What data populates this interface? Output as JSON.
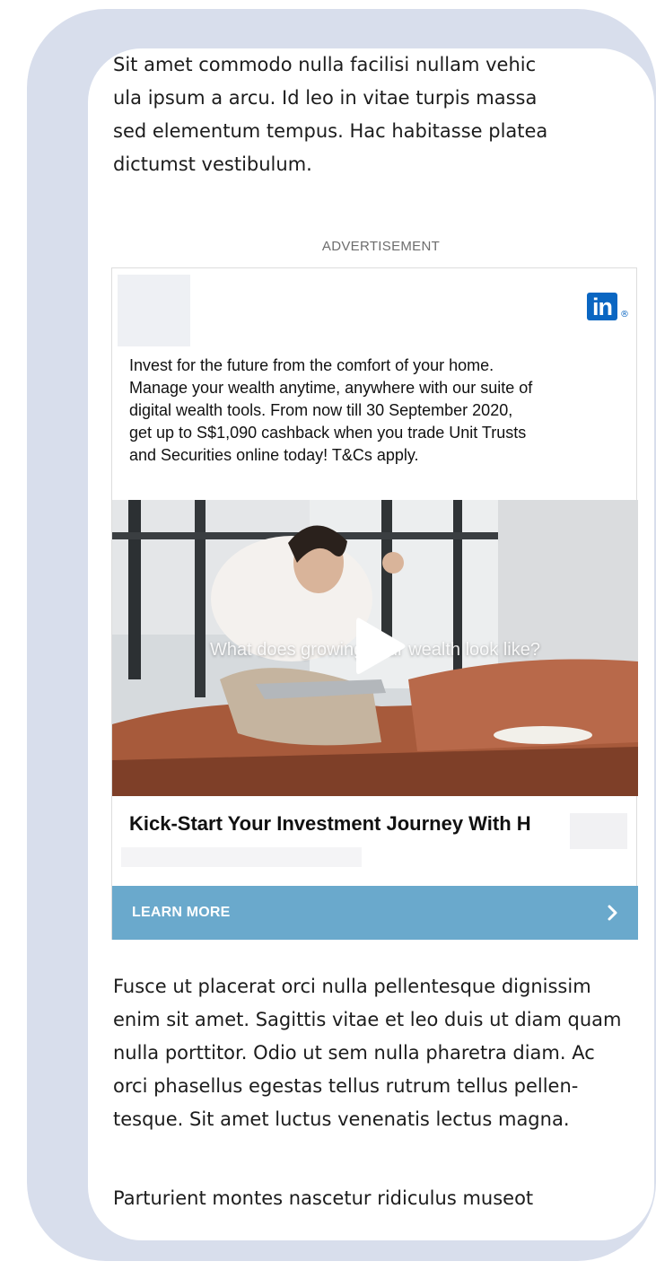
{
  "article": {
    "paragraph_top_lines": [
      "Sit amet commodo nulla facilisi nullam vehic",
      "ula ipsum a arcu. Id leo in vitae turpis massa",
      "sed elementum tempus. Hac habitasse platea",
      "dictumst vestibulum."
    ],
    "paragraph_bottom_lines": [
      "Fusce ut placerat orci nulla pellentesque dignissim",
      "enim sit amet. Sagittis vitae et leo duis ut diam quam",
      "nulla porttitor. Odio ut sem nulla pharetra diam. Ac",
      "orci phasellus egestas tellus rutrum tellus pellen-",
      "tesque. Sit amet luctus venenatis lectus magna."
    ],
    "paragraph_last_lines": [
      "Parturient montes nascetur ridiculus museot"
    ]
  },
  "ad": {
    "label": "ADVERTISEMENT",
    "network_logo_text": "in",
    "network_logo_mark": "®",
    "network_logo_icon": "linkedin-logo",
    "body_lines": [
      "Invest for the future from the comfort of your home.",
      "Manage your wealth anytime, anywhere with our suite of",
      "digital wealth tools. From now till 30 September 2020,",
      "get up to S$1,090 cashback when you trade Unit Trusts",
      "and Securities online today! T&Cs apply."
    ],
    "video_caption": "What does growing your wealth look like?",
    "play_icon": "play-icon",
    "headline": "Kick-Start Your Investment Journey With H",
    "cta_label": "LEARN MORE",
    "cta_icon": "chevron-right-icon",
    "colors": {
      "frame": "#d8deec",
      "linkedin_blue": "#0a66c2",
      "cta_blue": "#6aa9cc"
    }
  }
}
